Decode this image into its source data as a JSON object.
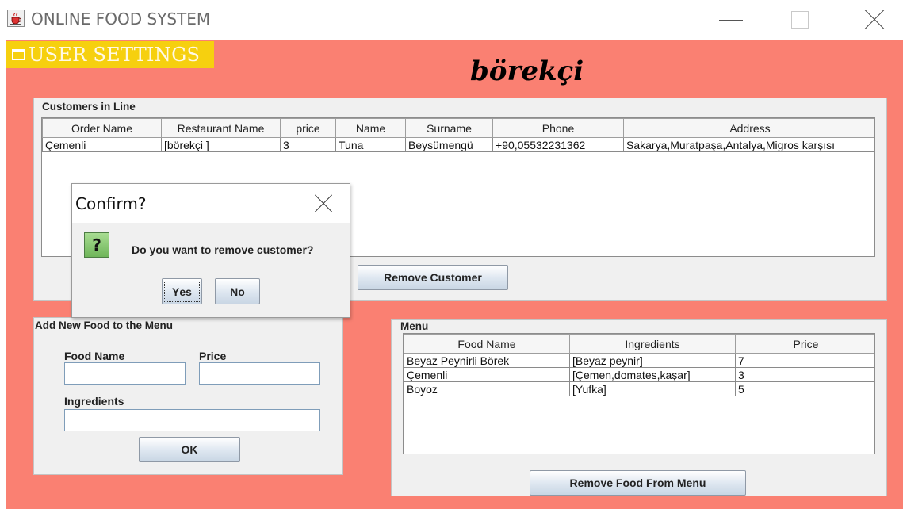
{
  "window": {
    "title": "ONLINE FOOD SYSTEM",
    "app_icon": "java-coffee-cup-icon",
    "controls": [
      "minimize-icon",
      "maximize-icon",
      "close-icon"
    ]
  },
  "menu": {
    "user_settings": "USER SETTINGS",
    "icon": "window-icon"
  },
  "shop_name": "börekçi",
  "customers_panel": {
    "legend": "Customers in Line",
    "columns": [
      "Order Name",
      "Restaurant Name",
      "price",
      "Name",
      "Surname",
      "Phone",
      "Address"
    ],
    "rows": [
      [
        "Çemenli",
        "[börekçi ]",
        "3",
        "Tuna",
        "Beysümengü",
        "+90,05532231362",
        "Sakarya,Muratpaşa,Antalya,Migros karşısı"
      ]
    ],
    "remove_button": "Remove Customer"
  },
  "add_food_panel": {
    "legend": "Add New Food to the Menu",
    "food_name_label": "Food Name",
    "price_label": "Price",
    "ingredients_label": "Ingredients",
    "food_name_value": "",
    "price_value": "",
    "ingredients_value": "",
    "ok_button": "OK"
  },
  "menu_panel": {
    "legend": "Menu",
    "columns": [
      "Food Name",
      "Ingredients",
      "Price"
    ],
    "rows": [
      [
        "Beyaz Peynirli Börek",
        "[Beyaz peynir]",
        "7"
      ],
      [
        "Çemenli",
        "[Çemen,domates,kaşar]",
        "3"
      ],
      [
        "Boyoz",
        "[Yufka]",
        "5"
      ]
    ],
    "remove_button": "Remove Food From Menu"
  },
  "dialog": {
    "title": "Confirm?",
    "icon": "question-icon",
    "icon_glyph": "?",
    "message": "Do you want to remove customer?",
    "yes_mnemonic": "Y",
    "yes_rest": "es",
    "no_mnemonic": "N",
    "no_rest": "o"
  },
  "colors": {
    "background": "#fa8072",
    "menu_highlight": "#f6d00f",
    "panel": "#f0f0f0"
  }
}
